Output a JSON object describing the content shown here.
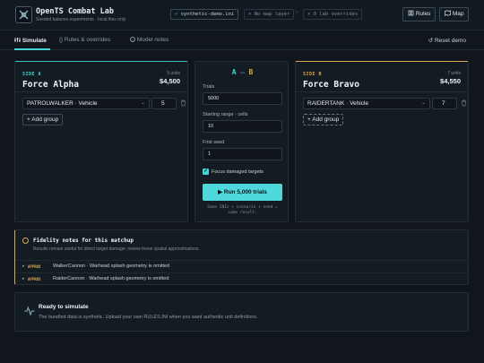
{
  "header": {
    "title": "OpenTS Combat Lab",
    "subtitle": "Seeded balance experiments · local files only",
    "pills": [
      "synthetic-demo.ini",
      "No map layer",
      "0 lab overrides"
    ],
    "pill_icons": [
      "✓",
      "×",
      "×"
    ],
    "rules_label": "Rules",
    "map_label": "Map"
  },
  "tabs": {
    "simulate": "Simulate",
    "rules": "Rules & overrides",
    "model": "Model notes",
    "reset": "Reset demo"
  },
  "side_a": {
    "label": "SIDE A",
    "name": "Force Alpha",
    "units": "5 units",
    "cost": "$4,500",
    "unit": "PATROLWALKER · Vehicle",
    "quantity": "5",
    "add_group": "+ Add group"
  },
  "side_b": {
    "label": "SIDE B",
    "name": "Force Bravo",
    "units": "7 units",
    "cost": "$4,550",
    "unit": "RAIDERTANK · Vehicle",
    "quantity": "7",
    "add_group": "+ Add group"
  },
  "center": {
    "a": "A",
    "b": "B",
    "trials_label": "Trials",
    "trials_value": "5000",
    "range_label": "Starting range · cells",
    "range_value": "10",
    "seed_label": "First seed",
    "seed_value": "1",
    "focus_label": "Focus damaged targets",
    "focus_checked": true,
    "run_label": "Run 5,000 trials",
    "hint_line1": "Same INIs + scenario + seed =",
    "hint_line2": "same result."
  },
  "notes": {
    "title": "Fidelity notes for this matchup",
    "subtitle": "Results remain useful for direct target damage; review these spatial approximations.",
    "items": [
      {
        "tag": "APPROX",
        "text": "WalkerCannon · Warhead splash geometry is omitted"
      },
      {
        "tag": "APPROX",
        "text": "RaiderCannon · Warhead splash geometry is omitted"
      }
    ]
  },
  "ready": {
    "title": "Ready to simulate",
    "text": "The bundled data is synthetic. Upload your own RULES.INI when you want authentic unit definitions."
  },
  "colors": {
    "accent_a": "#44d4d4",
    "accent_b": "#d9a84a",
    "background": "#10161c"
  },
  "icons": [
    "app-logo-icon",
    "rules-book-icon",
    "map-icon",
    "play-icon",
    "reset-icon",
    "trash-icon",
    "warning-icon",
    "pulse-icon"
  ]
}
